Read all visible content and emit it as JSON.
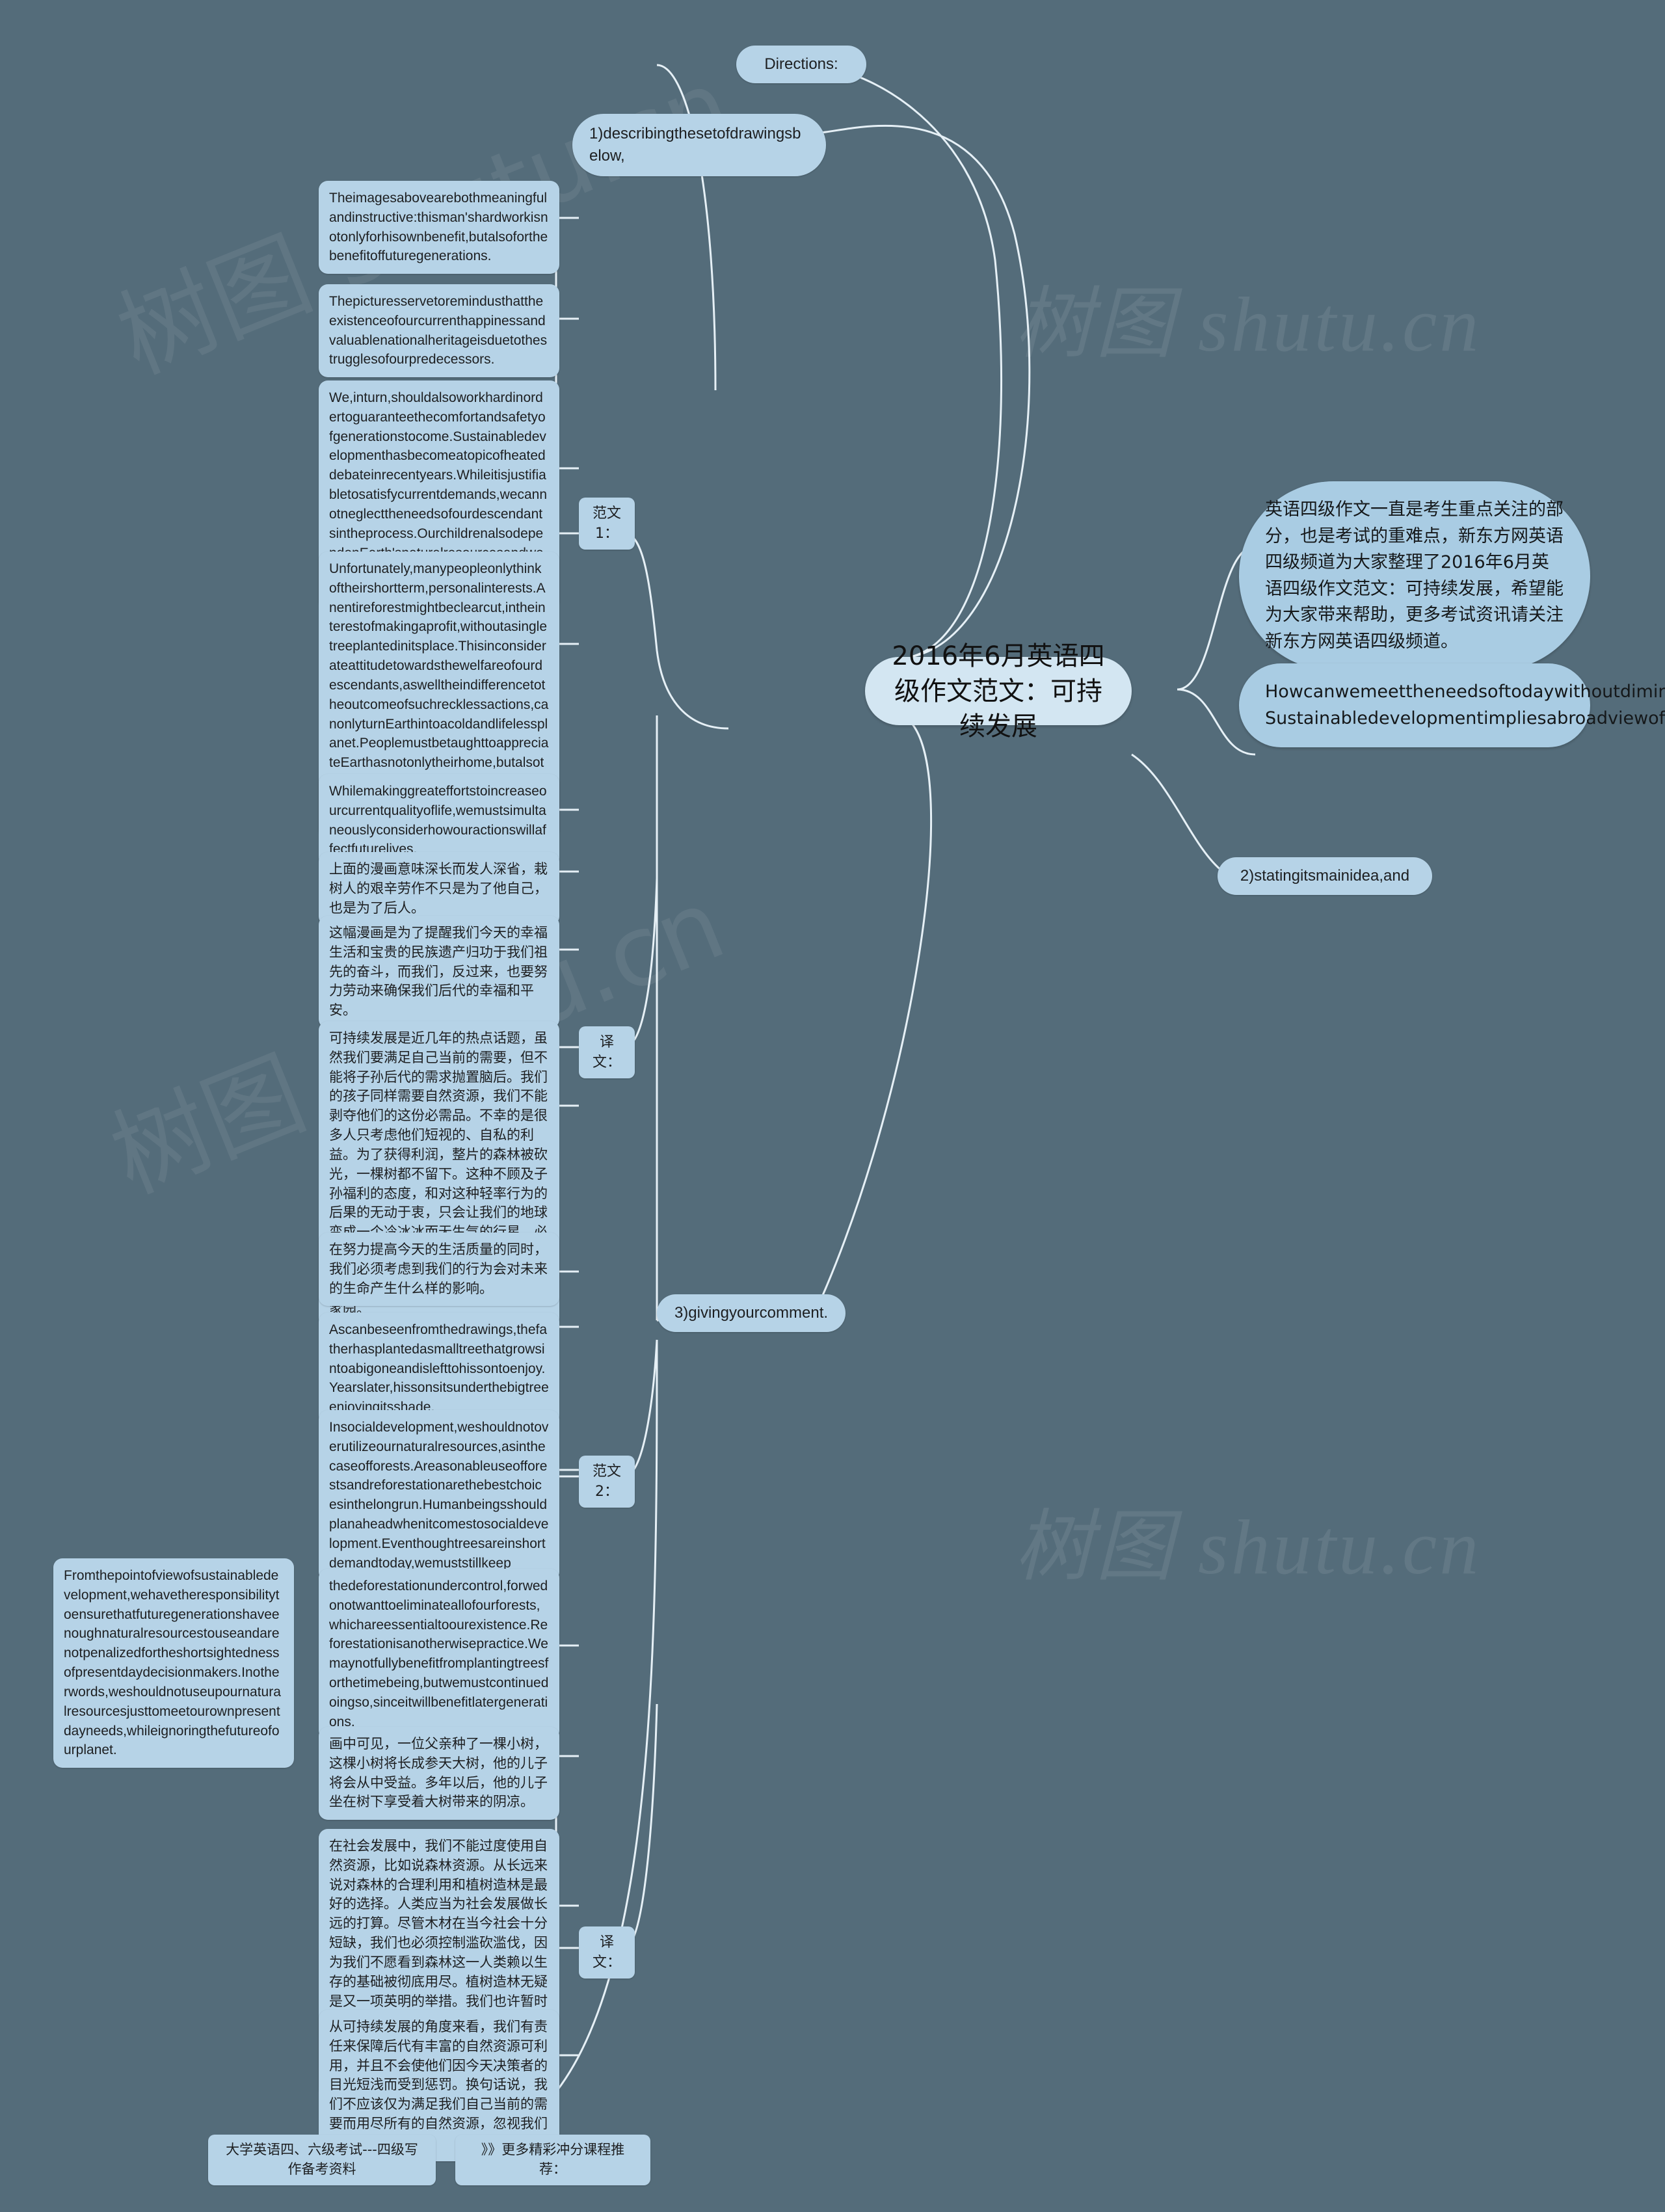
{
  "theme": {
    "background": "#546c7a",
    "node_fill": "#b6d3e7",
    "root_fill": "#d3e6f2",
    "branch_fill": "#a9cce3",
    "link_color": "#e6f0f6",
    "text_color": "#1d1f21"
  },
  "watermarks": [
    "树图 shutu.cn",
    "树图 shutu.cn",
    "树图 shutu.cn",
    "树图 shutu.cn"
  ],
  "root": {
    "title": "2016年6月英语四级作文范文：可持续发展"
  },
  "right_branch": {
    "intro": "英语四级作文一直是考生重点关注的部分，也是考试的重难点，新东方网英语四级频道为大家整理了2016年6月英语四级作文范文：可持续发展，希望能为大家带来帮助，更多考试资讯请关注新东方网英语四级频道。",
    "prompt": "Howcanwemeettheneedsoftodaywithoutdiminishingthecapacityoffuturegenerationstomeettheirs?Sustainabledevelopmentimpliesabroadviewofhumanwelfare,alongtermperspectiveaboutsocialdevelopment.Writeanessaywhichshouldcover:"
  },
  "directions": {
    "label": "Directions:",
    "item1": "1)describingthesetofdrawingsbelow,",
    "item2": "2)statingitsmainidea,and",
    "item3": "3)givingyourcomment."
  },
  "section_labels": {
    "fanwen1": "范文1：",
    "yiwen1": "译文：",
    "fanwen2": "范文2：",
    "yiwen2": "译文："
  },
  "essay1": {
    "paragraphs": [
      "Theimagesabovearebothmeaningfulandinstructive:thisman'shardworkisnotonlyforhisownbenefit,butalsoforthebenefitoffuturegenerations.",
      "Thepicturesservetoremindusthattheexistenceofourcurrenthappinessandvaluablenationalheritageisduetothestrugglesofourpredecessors.",
      "We,inturn,shouldalsoworkhardinordertoguaranteethecomfortandsafetyofgenerationstocome.Sustainabledevelopmenthasbecomeatopicofheateddebateinrecentyears.Whileitisjustifiabletosatisfycurrentdemands,wecannotneglecttheneedsofourdescendantsintheprocess.OurchildrenalsodependonEarth'snaturalresourcesandweshouldnotdeprivethemofsuchnecessities.",
      "Unfortunately,manypeopleonlythinkoftheirshortterm,personalinterests.Anentireforestmightbeclearcut,intheinterestofmakingaprofit,withoutasingletreeplantedinitsplace.Thisinconsiderateattitudetowardsthewelfareofourdescendants,aswelltheindifferencetotheoutcomeofsuchrecklessactions,canonlyturnEarthintoacoldandlifelessplanet.PeoplemustbetaughttoappreciateEarthasnotonlytheirhome,butalsothehomeofourchildrenandgrandchildren,aswellasallotherplantsandanimals.",
      "Whilemakinggreateffortstoincreaseourcurrentqualityoflife,wemustsimultaneouslyconsiderhowouractionswillaffectfuturelives."
    ]
  },
  "translation1": {
    "paragraphs": [
      "上面的漫画意味深长而发人深省，栽树人的艰辛劳作不只是为了他自己，也是为了后人。",
      "这幅漫画是为了提醒我们今天的幸福生活和宝贵的民族遗产归功于我们祖先的奋斗，而我们，反过来，也要努力劳动来确保我们后代的幸福和平安。",
      "可持续发展是近几年的热点话题，虽然我们要满足自己当前的需要，但不能将子孙后代的需求抛置脑后。我们的孩子同样需要自然资源，我们不能剥夺他们的这份必需品。不幸的是很多人只考虑他们短视的、自私的利益。为了获得利润，整片的森林被砍光，一棵树都不留下。这种不顾及子孙福利的态度，和对这种轻率行为的后果的无动于衷，只会让我们的地球变成一个冷冰冰而无生气的行星。必须告诫人们的是：地球不仅是他们的家园，也是他们的孩子和所有后代的家园，还是其他所有的植物和动物的家园。",
      "在努力提高今天的生活质量的同时，我们必须考虑到我们的行为会对未来的生命产生什么样的影响。"
    ]
  },
  "essay2": {
    "paragraphs": [
      "Ascanbeseenfromthedrawings,thefatherhasplantedasmalltreethatgrowsintoabigoneandislefttohissontoenjoy.Yearslater,hissonsitsunderthebigtreeenjoyingitsshade.",
      "Insocialdevelopment,weshouldnotoverutilizeournaturalresources,asinthecaseofforests.Areasonableuseofforestsandreforestationarethebestchoicesinthelongrun.Humanbeingsshouldplanaheadwhenitcomestosocialdevelopment.Eventhoughtreesareinshortdemandtoday,wemuststillkeep",
      "thedeforestationundercontrol,forwedonotwanttoeliminateallofourforests,whichareessentialtoourexistence.Reforestationisanotherwisepractice.Wemaynotfullybenefitfromplantingtreesforthetimebeing,butwemustcontinuedoingso,sinceitwillbenefitlatergenerations.",
      "Fromthepointofviewofsustainabledevelopment,wehavetheresponsibilitytoensurethatfuturegenerationshaveenoughnaturalresourcestouseandarenotpenalizedfortheshortsightednessofpresentdaydecisionmakers.Inotherwords,weshouldnotuseupournaturalresourcesjusttomeetourownpresentdayneeds,whileignoringthefutureofourplanet."
    ]
  },
  "translation2": {
    "paragraphs": [
      "画中可见，一位父亲种了一棵小树，这棵小树将长成参天大树，他的儿子将会从中受益。多年以后，他的儿子坐在树下享受着大树带来的阴凉。",
      "在社会发展中，我们不能过度使用自然资源，比如说森林资源。从长远来说对森林的合理利用和植树造林是最好的选择。人类应当为社会发展做长远的打算。尽管木材在当今社会十分短缺，我们也必须控制滥砍滥伐，因为我们不愿看到森林这一人类赖以生存的基础被彻底用尽。植树造林无疑是又一项英明的举措。我们也许暂时不能够充分享受植树给我们带来的益处，但是我们必须继续将这一举措坚持下去，因为它会使我们的后代受益。",
      "从可持续发展的角度来看，我们有责任来保障后代有丰富的自然资源可利用，并且不会使他们因今天决策者的目光短浅而受到惩罚。换句话说，我们不应该仅为满足我们自己当前的需要而用尽所有的自然资源，忽视我们后代的需求。"
    ]
  },
  "footer": {
    "resource_label": "大学英语四、六级考试---四级写作备考资料",
    "course_label": "》》更多精彩冲分课程推荐："
  }
}
